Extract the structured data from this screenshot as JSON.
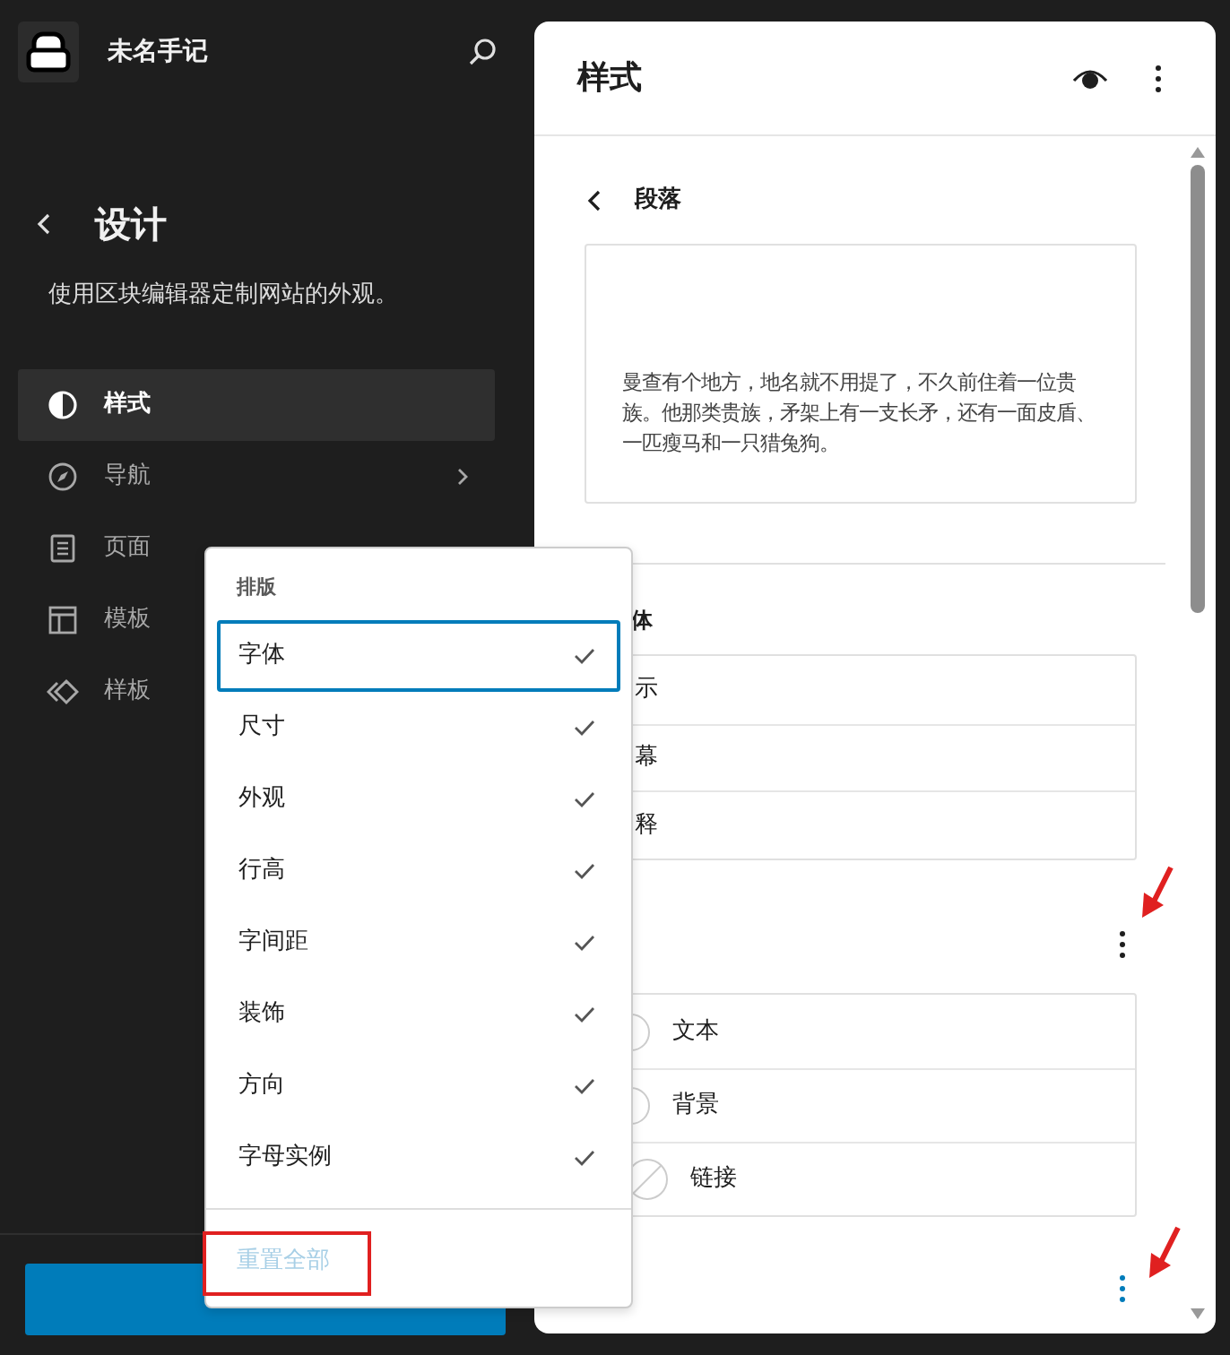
{
  "sidebar": {
    "site_title": "未名手记",
    "back_title": "设计",
    "description": "使用区块编辑器定制网站的外观。",
    "items": [
      {
        "label": "样式",
        "selected": true,
        "chevron": false
      },
      {
        "label": "导航",
        "selected": false,
        "chevron": true
      },
      {
        "label": "页面",
        "selected": false,
        "chevron": false
      },
      {
        "label": "模板",
        "selected": false,
        "chevron": false
      },
      {
        "label": "样板",
        "selected": false,
        "chevron": false
      }
    ]
  },
  "panel": {
    "title": "样式",
    "breadcrumb": "段落",
    "preview_text": "曼查有个地方，地名就不用提了，不久前住着一位贵族。他那类贵族，矛架上有一支长矛，还有一面皮盾、一匹瘦马和一只猎兔狗。",
    "variants_heading": "体",
    "variants": [
      "示",
      "幕",
      "释"
    ],
    "colors": [
      {
        "label": "文本",
        "kind": "swatch"
      },
      {
        "label": "背景",
        "kind": "swatch"
      },
      {
        "label": "链接",
        "kind": "empty"
      }
    ]
  },
  "menu": {
    "heading": "排版",
    "items": [
      {
        "label": "字体",
        "checked": true,
        "selected": true
      },
      {
        "label": "尺寸",
        "checked": true,
        "selected": false
      },
      {
        "label": "外观",
        "checked": true,
        "selected": false
      },
      {
        "label": "行高",
        "checked": true,
        "selected": false
      },
      {
        "label": "字间距",
        "checked": true,
        "selected": false
      },
      {
        "label": "装饰",
        "checked": true,
        "selected": false
      },
      {
        "label": "方向",
        "checked": true,
        "selected": false
      },
      {
        "label": "字母实例",
        "checked": true,
        "selected": false
      }
    ],
    "reset": {
      "label": "重置全部",
      "disabled": true
    }
  }
}
